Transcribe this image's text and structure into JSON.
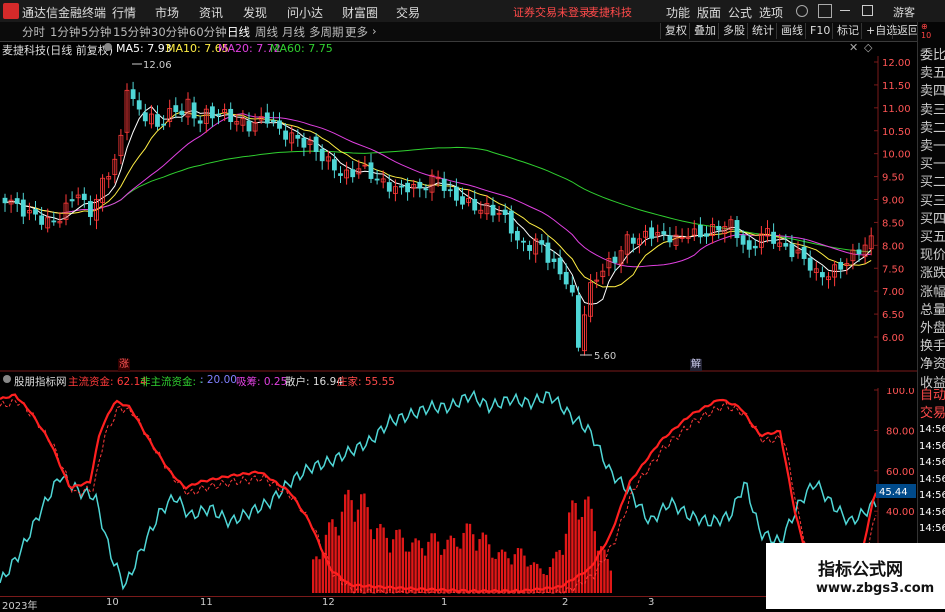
{
  "app": {
    "title": "通达信金融终端"
  },
  "menu": {
    "items": [
      "行情",
      "市场",
      "资讯",
      "发现",
      "问小达",
      "财富圈",
      "交易"
    ],
    "warn1": "证券交易未登录",
    "warn2": "麦捷科技",
    "right": [
      "功能",
      "版面",
      "公式",
      "选项"
    ],
    "guest": "游客"
  },
  "periods": [
    "分时",
    "1分钟",
    "5分钟",
    "15分钟",
    "30分钟",
    "60分钟",
    "日线",
    "周线",
    "月线",
    "多周期",
    "更多"
  ],
  "active_period": "日线",
  "toolbar_right": [
    "复权",
    "叠加",
    "多股",
    "统计",
    "画线",
    "F10",
    "标记",
    "+自选",
    "返回"
  ],
  "stock": {
    "name": "麦捷科技(日线 前复权)",
    "ma5": "MA5: 7.93",
    "ma10": "MA10: 7.65",
    "ma20": "MA20: 7.72",
    "ma60": "MA60: 7.75",
    "high_label": "12.06",
    "low_label": "5.60",
    "zhang": "涨",
    "jie": "解"
  },
  "price_axis": [
    "12.00",
    "11.50",
    "11.00",
    "10.50",
    "10.00",
    "9.50",
    "9.00",
    "8.50",
    "8.00",
    "7.50",
    "7.00",
    "6.50",
    "6.00"
  ],
  "indicator": {
    "name": "股朋指标网",
    "main": "主流资金: 62.14",
    "nonmain": "非主流资金: -",
    "val20": ": 20.00",
    "xc": "吸筹: 0.25",
    "sh": "散户: 16.94",
    "zj": "庄家: 55.55",
    "axis": [
      "100.0",
      "80.00",
      "60.00",
      "40.00"
    ],
    "cur": "45.44"
  },
  "dates": [
    "2023年",
    "10",
    "11",
    "12",
    "1",
    "2",
    "3"
  ],
  "side": [
    "委比",
    "卖五",
    "卖四",
    "卖三",
    "卖二",
    "卖一",
    "买一",
    "买二",
    "买三",
    "买四",
    "买五",
    "现价",
    "涨跌",
    "涨幅",
    "总量",
    "外盘",
    "换手",
    "净资",
    "收益"
  ],
  "side2": [
    "自动",
    "交易"
  ],
  "times": [
    "14:56",
    "14:56",
    "14:56",
    "14:56",
    "14:56",
    "14:56",
    "14:56"
  ],
  "watermark": {
    "text": "指标公式网",
    "url": "www.zbgs3.com"
  },
  "colors": {
    "up": "#ff3a3a",
    "down": "#4fd6d6",
    "ma5": "#ffffff",
    "ma10": "#ffee44",
    "ma20": "#e040e0",
    "ma60": "#30d030"
  }
}
